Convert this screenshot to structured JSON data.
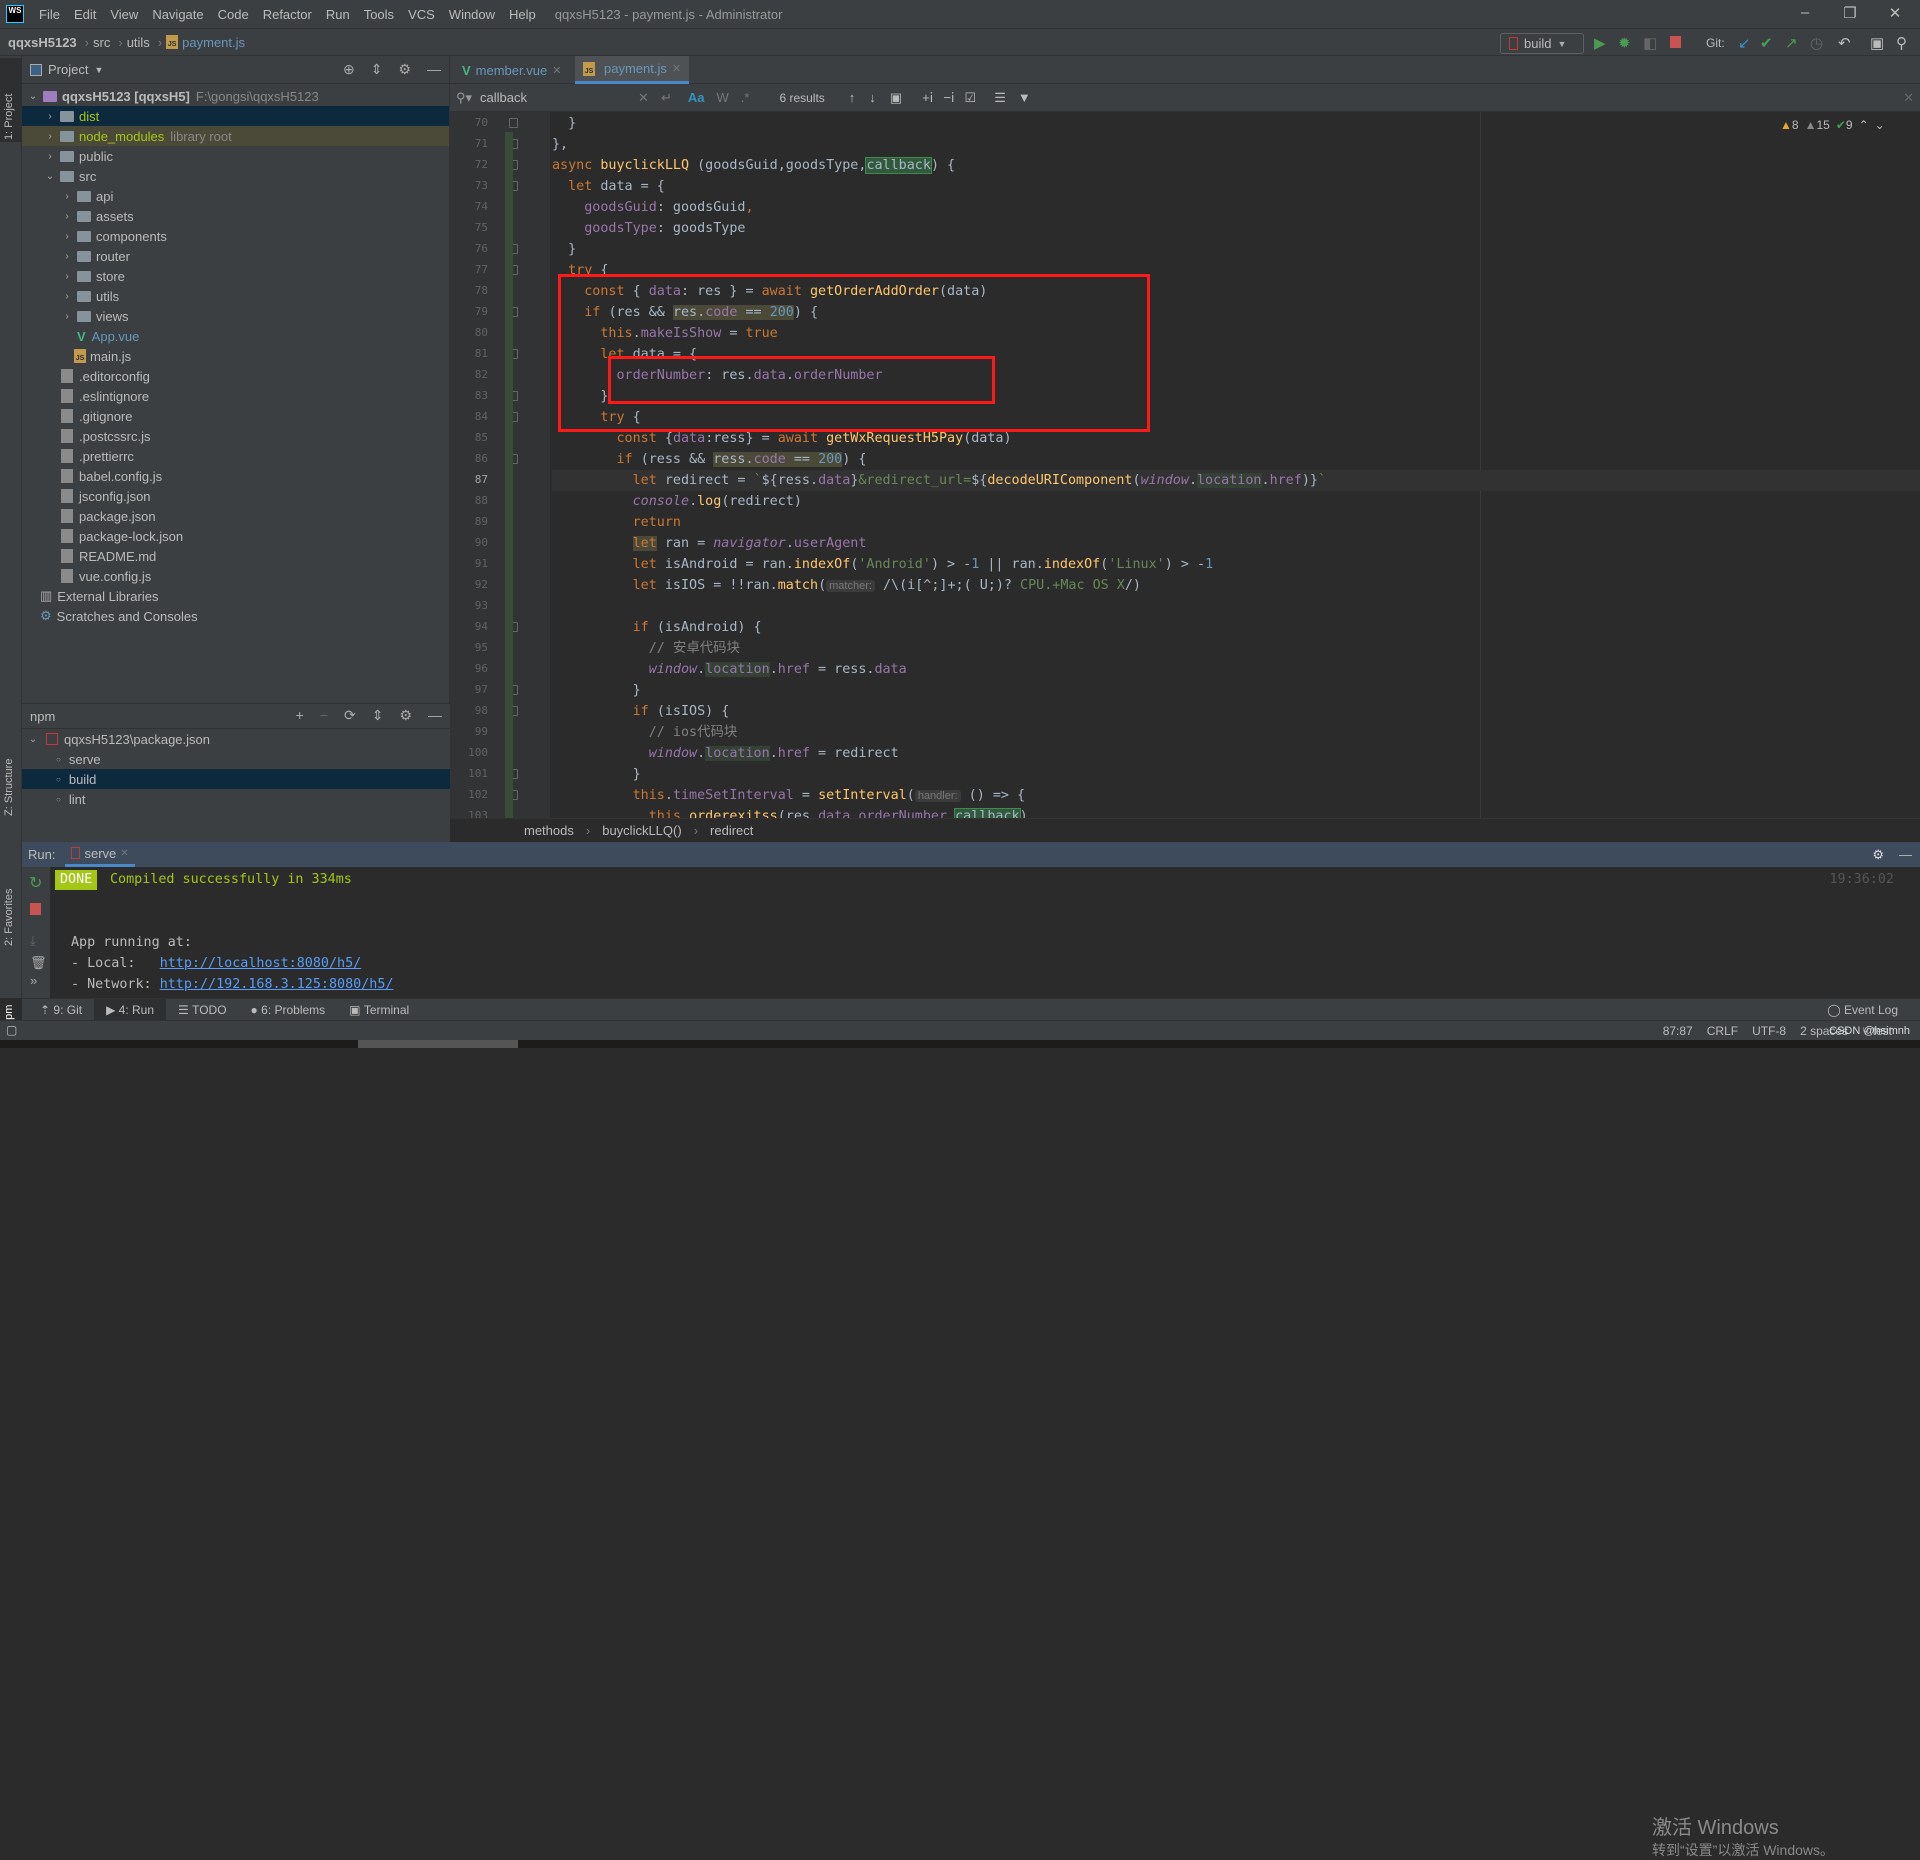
{
  "title_bar": {
    "logo": "WS",
    "menus": [
      "File",
      "Edit",
      "View",
      "Navigate",
      "Code",
      "Refactor",
      "Run",
      "Tools",
      "VCS",
      "Window",
      "Help"
    ],
    "window_title": "qqxsH5123 - payment.js - Administrator"
  },
  "nav_bar": {
    "crumbs": [
      "qqxsH5123",
      "src",
      "utils",
      "payment.js"
    ],
    "run_config": "build",
    "git_label": "Git:"
  },
  "left_strip": {
    "project": "1: Project",
    "structure": "Z: Structure",
    "favorites": "2: Favorites",
    "npm": "npm"
  },
  "project": {
    "title": "Project",
    "items": [
      {
        "label": "qqxsH5123 [qqxsH5]",
        "extra": "F:\\gongsi\\qqxsH5123",
        "level": 0,
        "type": "root",
        "expanded": true
      },
      {
        "label": "dist",
        "level": 1,
        "type": "folder",
        "state": "selected"
      },
      {
        "label": "node_modules",
        "extra": "library root",
        "level": 1,
        "type": "folder",
        "state": "library"
      },
      {
        "label": "public",
        "level": 1,
        "type": "folder"
      },
      {
        "label": "src",
        "level": 1,
        "type": "folder",
        "expanded": true
      },
      {
        "label": "api",
        "level": 2,
        "type": "folder"
      },
      {
        "label": "assets",
        "level": 2,
        "type": "folder"
      },
      {
        "label": "components",
        "level": 2,
        "type": "folder"
      },
      {
        "label": "router",
        "level": 2,
        "type": "folder"
      },
      {
        "label": "store",
        "level": 2,
        "type": "folder"
      },
      {
        "label": "utils",
        "level": 2,
        "type": "folder"
      },
      {
        "label": "views",
        "level": 2,
        "type": "folder"
      },
      {
        "label": "App.vue",
        "level": 2,
        "type": "vue"
      },
      {
        "label": "main.js",
        "level": 2,
        "type": "js"
      },
      {
        "label": ".editorconfig",
        "level": 1,
        "type": "file"
      },
      {
        "label": ".eslintignore",
        "level": 1,
        "type": "file"
      },
      {
        "label": ".gitignore",
        "level": 1,
        "type": "file"
      },
      {
        "label": ".postcssrc.js",
        "level": 1,
        "type": "file"
      },
      {
        "label": ".prettierrc",
        "level": 1,
        "type": "file"
      },
      {
        "label": "babel.config.js",
        "level": 1,
        "type": "file"
      },
      {
        "label": "jsconfig.json",
        "level": 1,
        "type": "file"
      },
      {
        "label": "package.json",
        "level": 1,
        "type": "file"
      },
      {
        "label": "package-lock.json",
        "level": 1,
        "type": "file"
      },
      {
        "label": "README.md",
        "level": 1,
        "type": "file"
      },
      {
        "label": "vue.config.js",
        "level": 1,
        "type": "file"
      },
      {
        "label": "External Libraries",
        "level": 0,
        "type": "lib"
      },
      {
        "label": "Scratches and Consoles",
        "level": 0,
        "type": "scratch"
      }
    ]
  },
  "npm": {
    "title": "npm",
    "package": "qqxsH5123\\package.json",
    "scripts": [
      "serve",
      "build",
      "lint"
    ],
    "selected": "build"
  },
  "tabs": [
    {
      "label": "member.vue",
      "icon": "vue-icon",
      "active": false
    },
    {
      "label": "payment.js",
      "icon": "js-icon",
      "active": true
    }
  ],
  "search": {
    "query": "callback",
    "results": "6 results",
    "match_case": "Aa",
    "words": "W",
    "regex": ".*"
  },
  "inspections": {
    "warnings": "8",
    "weak_warnings": "15",
    "typos": "9"
  },
  "editor": {
    "current_line": 87,
    "lines": [
      {
        "n": 70,
        "t": [
          [
            "p",
            "  }"
          ]
        ]
      },
      {
        "n": 71,
        "t": [
          [
            "p",
            "},"
          ]
        ]
      },
      {
        "n": 72,
        "t": [
          [
            "kw",
            "async "
          ],
          [
            "fn",
            "buyclickLLQ"
          ],
          [
            "p",
            " (goodsGuid,goodsType,"
          ],
          [
            "hlg",
            "callback"
          ],
          [
            "p",
            ") {"
          ]
        ]
      },
      {
        "n": 73,
        "t": [
          [
            "kw",
            "  let "
          ],
          [
            "p",
            "data = {"
          ]
        ]
      },
      {
        "n": 74,
        "t": [
          [
            "prop",
            "    goodsGuid"
          ],
          [
            "p",
            ": goodsGuid"
          ],
          [
            "kw",
            ","
          ]
        ]
      },
      {
        "n": 75,
        "t": [
          [
            "prop",
            "    goodsType"
          ],
          [
            "p",
            ": goodsType"
          ]
        ]
      },
      {
        "n": 76,
        "t": [
          [
            "p",
            "  }"
          ]
        ]
      },
      {
        "n": 77,
        "t": [
          [
            "kw",
            "  try "
          ],
          [
            "p",
            "{"
          ]
        ]
      },
      {
        "n": 78,
        "t": [
          [
            "kw",
            "    const "
          ],
          [
            "p",
            "{ "
          ],
          [
            "prop",
            "data"
          ],
          [
            "p",
            ": res } = "
          ],
          [
            "kw",
            "await "
          ],
          [
            "fn",
            "getOrderAddOrder"
          ],
          [
            "p",
            "(data)"
          ]
        ]
      },
      {
        "n": 79,
        "t": [
          [
            "kw",
            "    if "
          ],
          [
            "p",
            "(res && "
          ],
          [
            "hlw",
            "res."
          ],
          [
            "hlwprop",
            "code"
          ],
          [
            "hlw",
            " == "
          ],
          [
            "hlwnum",
            "200"
          ],
          [
            "p",
            ") {"
          ]
        ]
      },
      {
        "n": 80,
        "t": [
          [
            "kw",
            "      this"
          ],
          [
            "p",
            "."
          ],
          [
            "prop",
            "makeIsShow"
          ],
          [
            "p",
            " = "
          ],
          [
            "kw",
            "true"
          ]
        ]
      },
      {
        "n": 81,
        "t": [
          [
            "kw",
            "      let "
          ],
          [
            "p",
            "data = {"
          ]
        ]
      },
      {
        "n": 82,
        "t": [
          [
            "prop",
            "        orderNumber"
          ],
          [
            "p",
            ": res."
          ],
          [
            "prop",
            "data"
          ],
          [
            "p",
            "."
          ],
          [
            "prop",
            "orderNumber"
          ]
        ]
      },
      {
        "n": 83,
        "t": [
          [
            "p",
            "      }"
          ]
        ]
      },
      {
        "n": 84,
        "t": [
          [
            "kw",
            "      try "
          ],
          [
            "p",
            "{"
          ]
        ]
      },
      {
        "n": 85,
        "t": [
          [
            "kw",
            "        const "
          ],
          [
            "p",
            "{"
          ],
          [
            "prop",
            "data"
          ],
          [
            "p",
            ":ress} = "
          ],
          [
            "kw",
            "await "
          ],
          [
            "fn",
            "getWxRequestH5Pay"
          ],
          [
            "p",
            "(data)"
          ]
        ]
      },
      {
        "n": 86,
        "t": [
          [
            "kw",
            "        if "
          ],
          [
            "p",
            "(ress && "
          ],
          [
            "hlw",
            "ress."
          ],
          [
            "hlwprop",
            "code"
          ],
          [
            "hlw",
            " == "
          ],
          [
            "hlwnum",
            "200"
          ],
          [
            "p",
            ") {"
          ]
        ]
      },
      {
        "n": 87,
        "t": [
          [
            "kw",
            "          let "
          ],
          [
            "p",
            "redirect = "
          ],
          [
            "str",
            "`"
          ],
          [
            "p",
            "${ress."
          ],
          [
            "prop",
            "data"
          ],
          [
            "p",
            "}"
          ],
          [
            "str",
            "&redirect_url="
          ],
          [
            "p",
            "${"
          ],
          [
            "fn",
            "decodeURIComponent"
          ],
          [
            "p",
            "("
          ],
          [
            "glob",
            "window"
          ],
          [
            "p",
            "."
          ],
          [
            "hlprop",
            "location"
          ],
          [
            "p",
            "."
          ],
          [
            "prop",
            "href"
          ],
          [
            "p",
            ")}"
          ],
          [
            "str",
            "`"
          ]
        ]
      },
      {
        "n": 88,
        "t": [
          [
            "glob",
            "          console"
          ],
          [
            "p",
            "."
          ],
          [
            "fn",
            "log"
          ],
          [
            "p",
            "(redirect)"
          ]
        ]
      },
      {
        "n": 89,
        "t": [
          [
            "kw",
            "          return"
          ]
        ]
      },
      {
        "n": 90,
        "t": [
          [
            "p",
            "          "
          ],
          [
            "hlwkw",
            "let"
          ],
          [
            "p",
            " ran = "
          ],
          [
            "glob",
            "navigator"
          ],
          [
            "p",
            "."
          ],
          [
            "prop",
            "userAgent"
          ]
        ]
      },
      {
        "n": 91,
        "t": [
          [
            "kw",
            "          let "
          ],
          [
            "p",
            "isAndroid = ran."
          ],
          [
            "fn",
            "indexOf"
          ],
          [
            "p",
            "("
          ],
          [
            "str",
            "'Android'"
          ],
          [
            "p",
            ") > -"
          ],
          [
            "num",
            "1"
          ],
          [
            "p",
            " || ran."
          ],
          [
            "fn",
            "indexOf"
          ],
          [
            "p",
            "("
          ],
          [
            "str",
            "'Linux'"
          ],
          [
            "p",
            ") > -"
          ],
          [
            "num",
            "1"
          ]
        ]
      },
      {
        "n": 92,
        "t": [
          [
            "kw",
            "          let "
          ],
          [
            "p",
            "isIOS = !!ran."
          ],
          [
            "fn",
            "match"
          ],
          [
            "p",
            "("
          ],
          [
            "hint",
            "matcher:"
          ],
          [
            "p",
            " /\\(i[^;]+;( U;)? "
          ],
          [
            "str",
            "CPU.+Mac OS X"
          ],
          [
            "p",
            "/)"
          ]
        ]
      },
      {
        "n": 93,
        "t": []
      },
      {
        "n": 94,
        "t": [
          [
            "kw",
            "          if "
          ],
          [
            "p",
            "(isAndroid) {"
          ]
        ]
      },
      {
        "n": 95,
        "t": [
          [
            "cmt",
            "            // 安卓代码块"
          ]
        ]
      },
      {
        "n": 96,
        "t": [
          [
            "glob",
            "            window"
          ],
          [
            "p",
            "."
          ],
          [
            "hlprop",
            "location"
          ],
          [
            "p",
            "."
          ],
          [
            "prop",
            "href"
          ],
          [
            "p",
            " = ress."
          ],
          [
            "prop",
            "data"
          ]
        ]
      },
      {
        "n": 97,
        "t": [
          [
            "p",
            "          }"
          ]
        ]
      },
      {
        "n": 98,
        "t": [
          [
            "kw",
            "          if "
          ],
          [
            "p",
            "(isIOS) {"
          ]
        ]
      },
      {
        "n": 99,
        "t": [
          [
            "cmt",
            "            // ios代码块"
          ]
        ]
      },
      {
        "n": 100,
        "t": [
          [
            "glob",
            "            window"
          ],
          [
            "p",
            "."
          ],
          [
            "hlprop",
            "location"
          ],
          [
            "p",
            "."
          ],
          [
            "prop",
            "href"
          ],
          [
            "p",
            " = redirect"
          ]
        ]
      },
      {
        "n": 101,
        "t": [
          [
            "p",
            "          }"
          ]
        ]
      },
      {
        "n": 102,
        "t": [
          [
            "kw",
            "          this"
          ],
          [
            "p",
            "."
          ],
          [
            "prop",
            "timeSetInterval"
          ],
          [
            "p",
            " = "
          ],
          [
            "fn",
            "setInterval"
          ],
          [
            "p",
            "("
          ],
          [
            "hint",
            "handler:"
          ],
          [
            "p",
            " () => {"
          ]
        ]
      },
      {
        "n": 103,
        "t": [
          [
            "kw",
            "            this"
          ],
          [
            "p",
            "."
          ],
          [
            "fn",
            "orderexitss"
          ],
          [
            "p",
            "(res."
          ],
          [
            "prop",
            "data"
          ],
          [
            "p",
            "."
          ],
          [
            "prop",
            "orderNumber"
          ],
          [
            "p",
            ","
          ],
          [
            "hlg",
            "callback"
          ],
          [
            "p",
            ")"
          ]
        ]
      }
    ]
  },
  "editor_breadcrumbs": [
    "methods",
    "buyclickLLQ()",
    "redirect"
  ],
  "run": {
    "label": "Run:",
    "tab": "serve",
    "badge": "DONE",
    "compiled": "Compiled successfully in 334ms",
    "time": "19:36:02",
    "app_running": "App running at:",
    "local_label": "- Local:   ",
    "local_url": "http://localhost:8080/h5/",
    "network_label": "- Network: ",
    "network_url": "http://192.168.3.125:8080/h5/"
  },
  "tool_windows": [
    {
      "label": "9: Git"
    },
    {
      "label": "4: Run",
      "active": true
    },
    {
      "label": "TODO"
    },
    {
      "label": "6: Problems"
    },
    {
      "label": "Terminal"
    }
  ],
  "event_log": "Event Log",
  "status": {
    "position": "87:87",
    "line_sep": "CRLF",
    "encoding": "UTF-8",
    "indent": "2 spaces",
    "branch": "test"
  },
  "watermark": {
    "line1": "激活 Windows",
    "line2": "转到“设置”以激活 Windows。",
    "csdn": "CSDN @hsimnh"
  },
  "colors": {
    "accent": "#4a88c7",
    "redbox": "#ff1a1a",
    "done_badge": "#a4c616"
  }
}
